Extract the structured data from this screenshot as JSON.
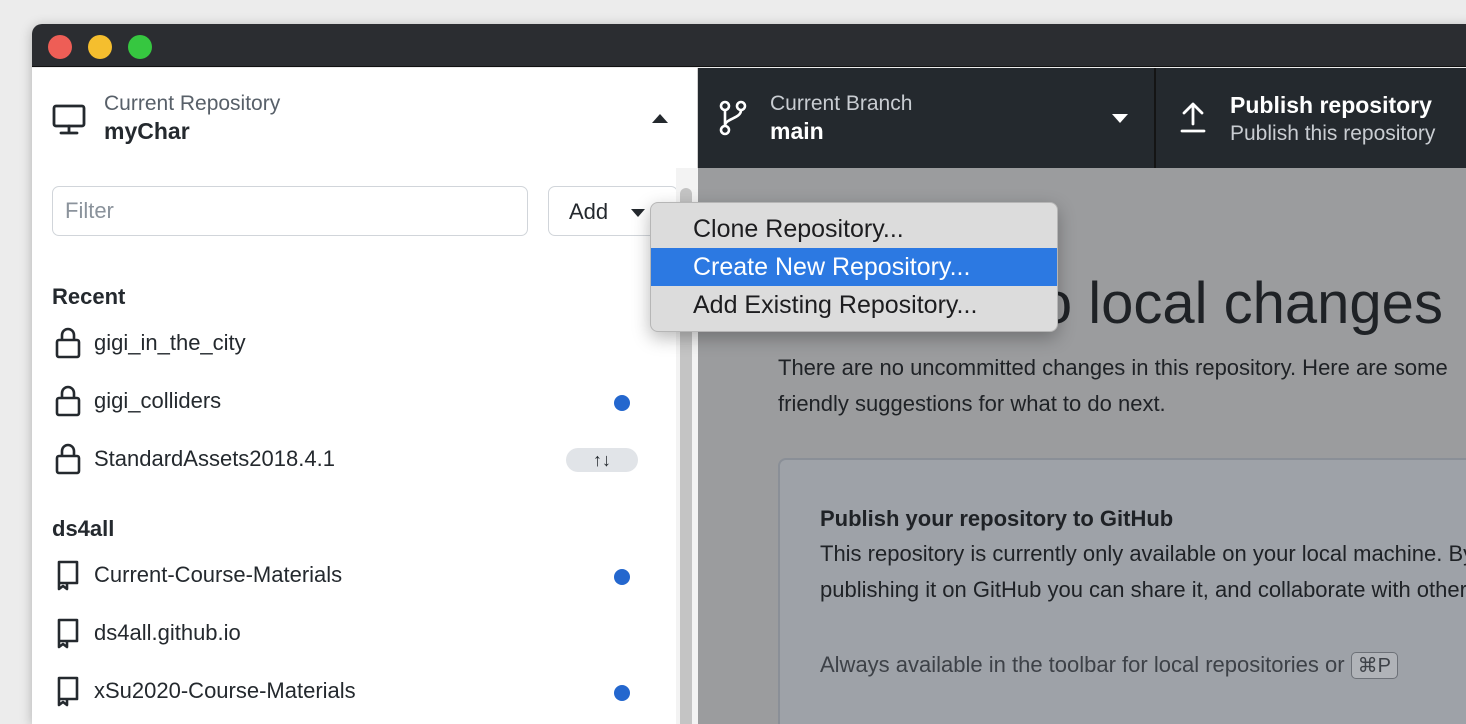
{
  "current_repository": {
    "label": "Current Repository",
    "value": "myChar"
  },
  "current_branch": {
    "label": "Current Branch",
    "value": "main"
  },
  "publish": {
    "title": "Publish repository",
    "subtitle": "Publish this repository"
  },
  "filter": {
    "placeholder": "Filter",
    "value": ""
  },
  "add_button": {
    "label": "Add"
  },
  "add_menu": {
    "items": [
      {
        "label": "Clone Repository...",
        "highlighted": false
      },
      {
        "label": "Create New Repository...",
        "highlighted": true
      },
      {
        "label": "Add Existing Repository...",
        "highlighted": false
      }
    ]
  },
  "groups": [
    {
      "name": "Recent",
      "repos": [
        {
          "name": "gigi_in_the_city",
          "icon": "lock-icon",
          "indicator": "none"
        },
        {
          "name": "gigi_colliders",
          "icon": "lock-icon",
          "indicator": "dot"
        },
        {
          "name": "StandardAssets2018.4.1",
          "icon": "lock-icon",
          "indicator": "arrows",
          "arrows_text": "↑↓"
        }
      ]
    },
    {
      "name": "ds4all",
      "repos": [
        {
          "name": "Current-Course-Materials",
          "icon": "repo-icon",
          "indicator": "dot"
        },
        {
          "name": "ds4all.github.io",
          "icon": "repo-icon",
          "indicator": "none"
        },
        {
          "name": "xSu2020-Course-Materials",
          "icon": "repo-icon",
          "indicator": "dot"
        }
      ]
    }
  ],
  "main": {
    "headline": "No local changes",
    "description": "There are no uncommitted changes in this repository. Here are some friendly suggestions for what to do next.",
    "card": {
      "title": "Publish your repository to GitHub",
      "body": "This repository is currently only available on your local machine. By publishing it on GitHub you can share it, and collaborate with others.",
      "note": "Always available in the toolbar for local repositories or",
      "shortcut": "⌘P"
    }
  },
  "colors": {
    "accent": "#2467ce",
    "menu_highlight": "#2c79e2",
    "toolbar": "#24292e"
  }
}
